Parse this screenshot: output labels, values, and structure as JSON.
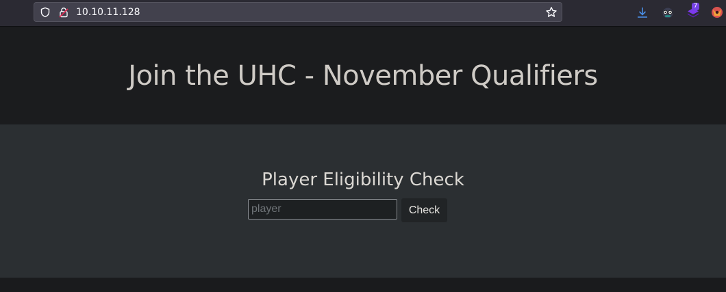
{
  "browser": {
    "url": "10.10.11.128",
    "icons": [
      "shield-icon",
      "insecure-lock-icon",
      "bookmark-star-icon",
      "downloads-icon",
      "extension-glasses-icon",
      "extension-layers-icon",
      "extension-fox-icon"
    ],
    "extension_badge": "7",
    "colors": {
      "toolbar": "#2b2a33",
      "urlbar": "#42414d",
      "accent_download": "#4a8fe7",
      "badge": "#7542e5"
    }
  },
  "page": {
    "title": "Join the UHC - November Qualifiers",
    "section_heading": "Player Eligibility Check",
    "form": {
      "input_value": "",
      "input_placeholder": "player",
      "button_label": "Check"
    },
    "colors": {
      "hero_bg": "#1b1c1e",
      "content_bg": "#2b2f32",
      "text": "#cfcbc6"
    }
  }
}
